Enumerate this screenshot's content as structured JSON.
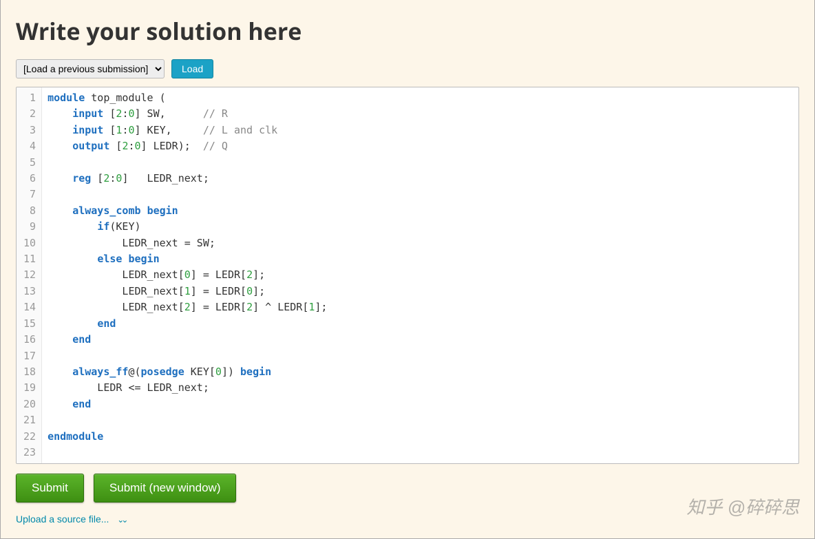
{
  "header": {
    "title": "Write your solution here"
  },
  "load_bar": {
    "select_label": "[Load a previous submission]",
    "load_button": "Load"
  },
  "code": {
    "lines": [
      [
        {
          "t": "module",
          "c": "kw"
        },
        {
          "t": " top_module (",
          "c": "id"
        }
      ],
      [
        {
          "t": "    ",
          "c": "id"
        },
        {
          "t": "input",
          "c": "kw"
        },
        {
          "t": " [",
          "c": "id"
        },
        {
          "t": "2",
          "c": "num"
        },
        {
          "t": ":",
          "c": "id"
        },
        {
          "t": "0",
          "c": "num"
        },
        {
          "t": "] SW,      ",
          "c": "id"
        },
        {
          "t": "// R",
          "c": "cmt"
        }
      ],
      [
        {
          "t": "    ",
          "c": "id"
        },
        {
          "t": "input",
          "c": "kw"
        },
        {
          "t": " [",
          "c": "id"
        },
        {
          "t": "1",
          "c": "num"
        },
        {
          "t": ":",
          "c": "id"
        },
        {
          "t": "0",
          "c": "num"
        },
        {
          "t": "] KEY,     ",
          "c": "id"
        },
        {
          "t": "// L and clk",
          "c": "cmt"
        }
      ],
      [
        {
          "t": "    ",
          "c": "id"
        },
        {
          "t": "output",
          "c": "kw"
        },
        {
          "t": " [",
          "c": "id"
        },
        {
          "t": "2",
          "c": "num"
        },
        {
          "t": ":",
          "c": "id"
        },
        {
          "t": "0",
          "c": "num"
        },
        {
          "t": "] LEDR);  ",
          "c": "id"
        },
        {
          "t": "// Q",
          "c": "cmt"
        }
      ],
      [],
      [
        {
          "t": "    ",
          "c": "id"
        },
        {
          "t": "reg",
          "c": "kw"
        },
        {
          "t": " [",
          "c": "id"
        },
        {
          "t": "2",
          "c": "num"
        },
        {
          "t": ":",
          "c": "id"
        },
        {
          "t": "0",
          "c": "num"
        },
        {
          "t": "]   LEDR_next;",
          "c": "id"
        }
      ],
      [],
      [
        {
          "t": "    ",
          "c": "id"
        },
        {
          "t": "always_comb",
          "c": "kw2"
        },
        {
          "t": " ",
          "c": "id"
        },
        {
          "t": "begin",
          "c": "kw"
        }
      ],
      [
        {
          "t": "        ",
          "c": "id"
        },
        {
          "t": "if",
          "c": "kw2"
        },
        {
          "t": "(KEY)",
          "c": "id"
        }
      ],
      [
        {
          "t": "            LEDR_next = SW;",
          "c": "id"
        }
      ],
      [
        {
          "t": "        ",
          "c": "id"
        },
        {
          "t": "else",
          "c": "kw2"
        },
        {
          "t": " ",
          "c": "id"
        },
        {
          "t": "begin",
          "c": "kw"
        }
      ],
      [
        {
          "t": "            LEDR_next[",
          "c": "id"
        },
        {
          "t": "0",
          "c": "num"
        },
        {
          "t": "] = LEDR[",
          "c": "id"
        },
        {
          "t": "2",
          "c": "num"
        },
        {
          "t": "];",
          "c": "id"
        }
      ],
      [
        {
          "t": "            LEDR_next[",
          "c": "id"
        },
        {
          "t": "1",
          "c": "num"
        },
        {
          "t": "] = LEDR[",
          "c": "id"
        },
        {
          "t": "0",
          "c": "num"
        },
        {
          "t": "];",
          "c": "id"
        }
      ],
      [
        {
          "t": "            LEDR_next[",
          "c": "id"
        },
        {
          "t": "2",
          "c": "num"
        },
        {
          "t": "] = LEDR[",
          "c": "id"
        },
        {
          "t": "2",
          "c": "num"
        },
        {
          "t": "] ^ LEDR[",
          "c": "id"
        },
        {
          "t": "1",
          "c": "num"
        },
        {
          "t": "];",
          "c": "id"
        }
      ],
      [
        {
          "t": "        ",
          "c": "id"
        },
        {
          "t": "end",
          "c": "kw"
        }
      ],
      [
        {
          "t": "    ",
          "c": "id"
        },
        {
          "t": "end",
          "c": "kw"
        }
      ],
      [],
      [
        {
          "t": "    ",
          "c": "id"
        },
        {
          "t": "always_ff",
          "c": "kw2"
        },
        {
          "t": "@(",
          "c": "id"
        },
        {
          "t": "posedge",
          "c": "kw2"
        },
        {
          "t": " KEY[",
          "c": "id"
        },
        {
          "t": "0",
          "c": "num"
        },
        {
          "t": "]) ",
          "c": "id"
        },
        {
          "t": "begin",
          "c": "kw"
        }
      ],
      [
        {
          "t": "        LEDR <= LEDR_next;",
          "c": "id"
        }
      ],
      [
        {
          "t": "    ",
          "c": "id"
        },
        {
          "t": "end",
          "c": "kw"
        }
      ],
      [],
      [
        {
          "t": "endmodule",
          "c": "kw"
        }
      ],
      []
    ]
  },
  "actions": {
    "submit": "Submit",
    "submit_new_window": "Submit (new window)",
    "upload_link": "Upload a source file..."
  },
  "watermark": "知乎 @碎碎思"
}
